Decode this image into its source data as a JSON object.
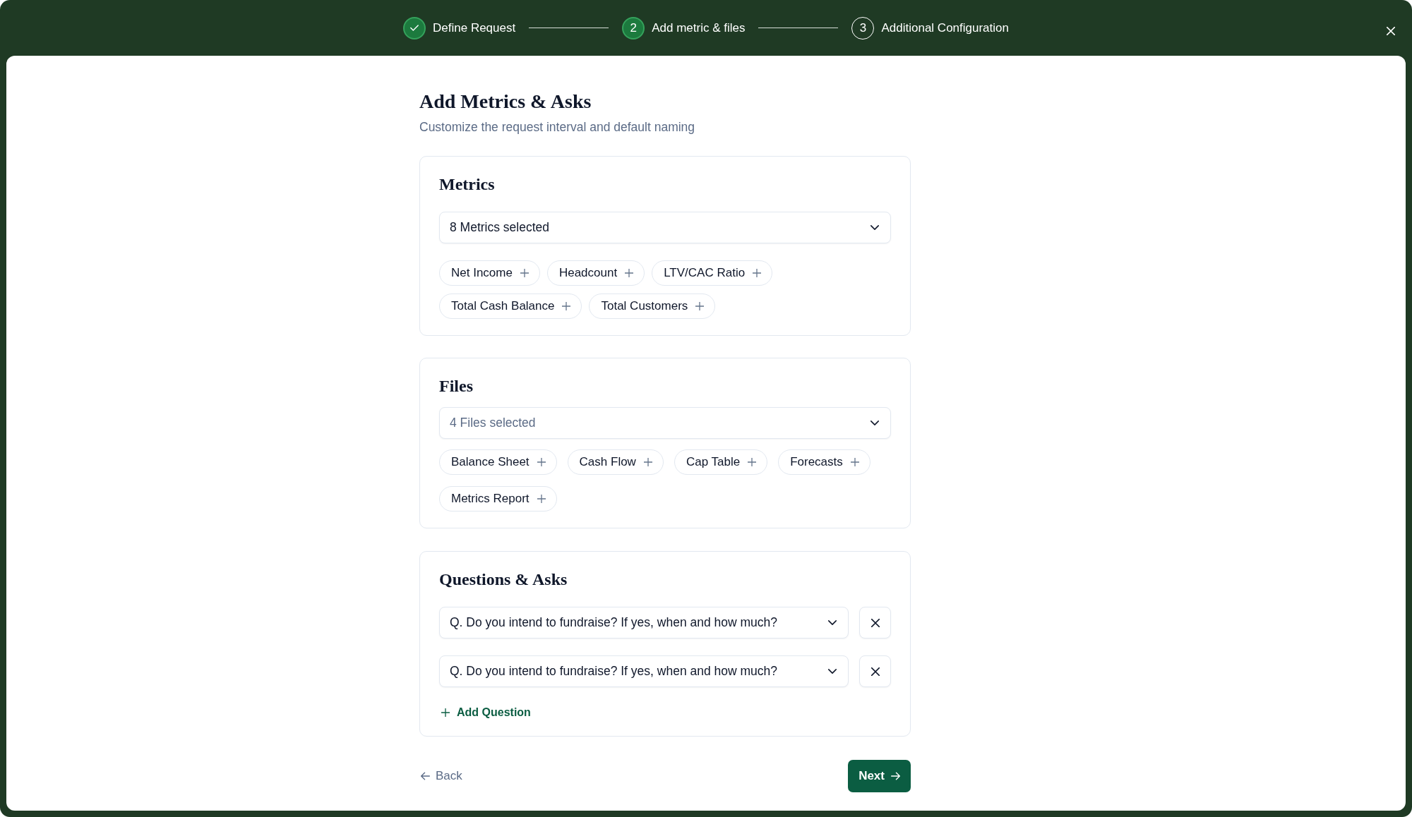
{
  "stepper": {
    "steps": [
      {
        "kind": "done",
        "label": "Define Request"
      },
      {
        "kind": "current",
        "number": "2",
        "label": "Add metric & files"
      },
      {
        "kind": "upcoming",
        "number": "3",
        "label": "Additional Configuration"
      }
    ]
  },
  "page": {
    "title": "Add Metrics & Asks",
    "subtitle": "Customize the request interval and default naming"
  },
  "metrics": {
    "title": "Metrics",
    "select": {
      "value": "8 Metrics selected"
    },
    "chips": [
      "Net Income",
      "Headcount",
      "LTV/CAC Ratio",
      "Total Cash Balance",
      "Total Customers"
    ]
  },
  "files": {
    "title": "Files",
    "select": {
      "placeholder": "4 Files selected"
    },
    "chips": [
      "Balance Sheet",
      "Cash Flow",
      "Cap Table",
      "Forecasts",
      "Metrics Report"
    ]
  },
  "questions": {
    "title": "Questions & Asks",
    "items": [
      {
        "value": "Q. Do you intend to fundraise? If yes, when and how much?"
      },
      {
        "value": "Q. Do you intend to fundraise? If yes, when and how much?"
      }
    ],
    "add_button": "Add Question"
  },
  "footer": {
    "back": "Back",
    "next": "Next"
  }
}
